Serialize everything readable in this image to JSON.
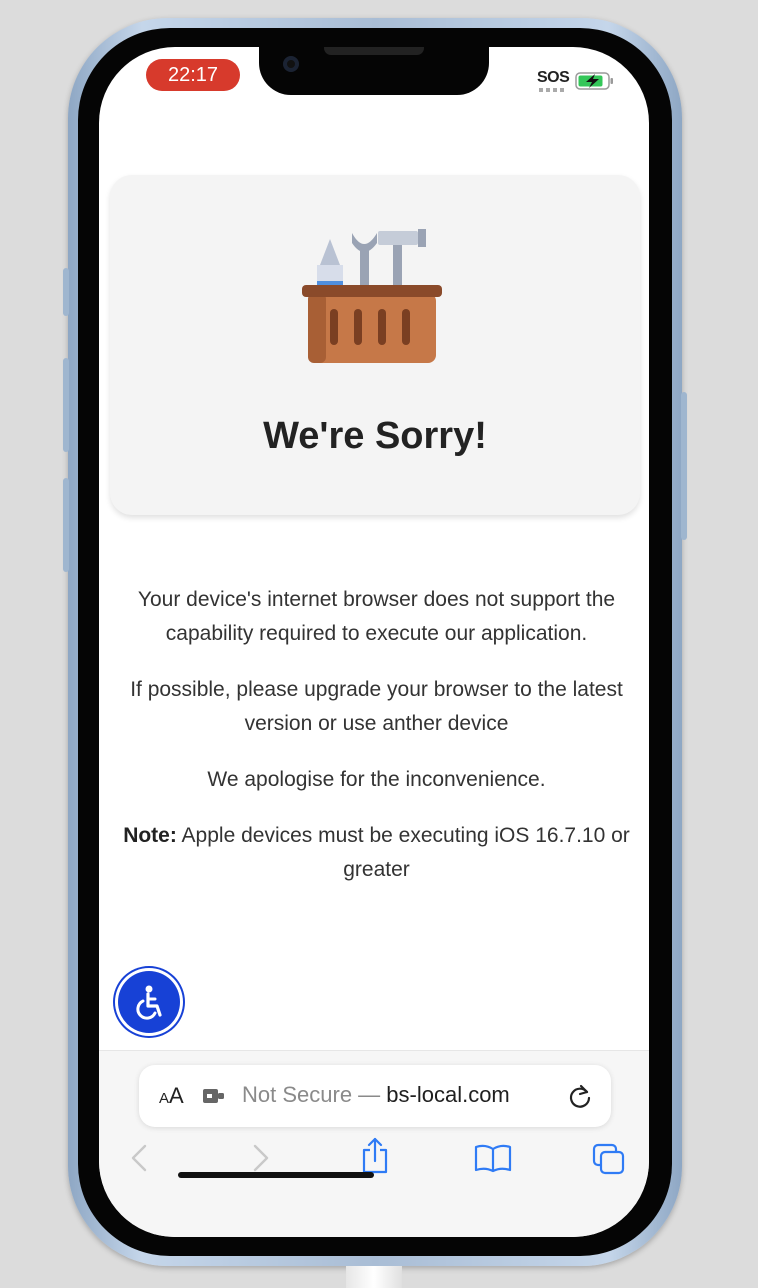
{
  "status_bar": {
    "time": "22:17",
    "sos": "SOS"
  },
  "error_card": {
    "illustration": "toolbox-icon",
    "title": "We're Sorry!"
  },
  "message": {
    "line1": "Your device's internet browser does not support the capability required to execute our application.",
    "line2": "If possible, please upgrade your browser to the latest version or use anther device",
    "line3": "We apologise for the inconvenience.",
    "note_label": "Note:",
    "note_text": " Apple devices must be executing iOS 16.7.10 or greater"
  },
  "accessibility_button": {
    "icon": "accessibility-wheelchair-icon",
    "color": "#1741d6"
  },
  "safari": {
    "text_size_label": "AA",
    "security_text": "Not Secure — ",
    "domain": "bs-local.com",
    "toolbar_icons": [
      "back-icon",
      "forward-icon",
      "share-icon",
      "bookmarks-icon",
      "tabs-icon"
    ],
    "accent": "#2f7bf5"
  }
}
